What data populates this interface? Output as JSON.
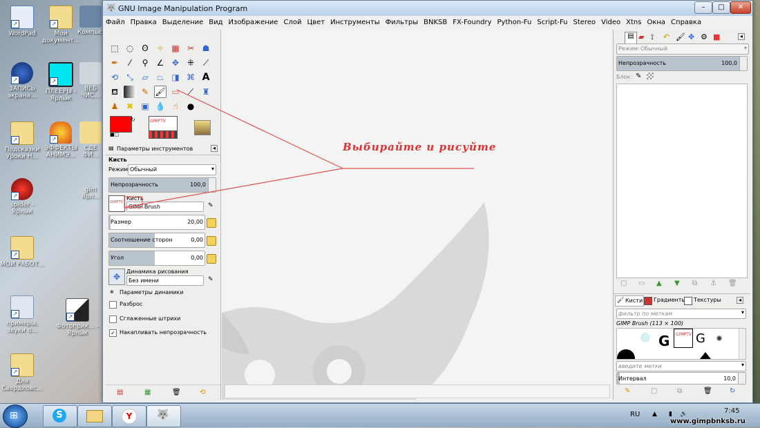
{
  "desktop": {
    "icons": [
      {
        "label": "WordPad"
      },
      {
        "label": "Мои документ..."
      },
      {
        "label": "Компьютер"
      },
      {
        "label": "ЗАПИСЬ экрана..."
      },
      {
        "label": "ПЛЕЕРЫ - Ярлык"
      },
      {
        "label": "ВЕБ ЧИС..."
      },
      {
        "label": "Подсказки Уроки Н..."
      },
      {
        "label": "ЭФФЕКТЫ АНИМЭ..."
      },
      {
        "label": "СДЕ ФИ..."
      },
      {
        "label": "spider - Ярлык"
      },
      {
        "label": "gim Ярл..."
      },
      {
        "label": "МОИ РАБОТ..."
      },
      {
        "label": "примеры, звуки о..."
      },
      {
        "label": "Фотоприк... - Ярлык"
      },
      {
        "label": "Для Свердловс..."
      }
    ]
  },
  "window": {
    "title": "GNU Image Manipulation Program",
    "minimize": "–",
    "maximize": "□",
    "close": "✕"
  },
  "menubar": [
    "Файл",
    "Правка",
    "Выделение",
    "Вид",
    "Изображение",
    "Слой",
    "Цвет",
    "Инструменты",
    "Фильтры",
    "BNKSB",
    "FX-Foundry",
    "Python-Fu",
    "Script-Fu",
    "Stereo",
    "Video",
    "Xtns",
    "Окна",
    "Справка"
  ],
  "toolbox": {
    "tab_title": "Параметры инструментов",
    "tool_name": "Кисть",
    "mode_label": "Режим:",
    "mode_value": "Обычный",
    "opacity_label": "Непрозрачность",
    "opacity_value": "100,0",
    "opacity_fraction": 1.0,
    "brush_label": "Кисть",
    "brush_value": "GIMP Brush",
    "size_label": "Размер",
    "size_value": "20,00",
    "aspect_label": "Соотношение сторон",
    "aspect_value": "0,00",
    "angle_label": "Угол",
    "angle_value": "0,00",
    "dynamics_label": "Динамика рисования",
    "dynamics_value": "Без имени",
    "dynamics_params": "Параметры динамики",
    "scatter": "Разброс",
    "smooth": "Сглаженные штрихи",
    "accumulate": "Накапливать непрозрачность",
    "brush_thumb_text": "GIMPTV",
    "fg_color": "#ff0000",
    "bg_color": "#ffffff"
  },
  "annotation": {
    "text": "Выбирайте и рисуйте",
    "color": "#e03030"
  },
  "layers": {
    "mode_label": "Режим:",
    "mode_value": "Обычный",
    "opacity_label": "Непрозрачность",
    "opacity_value": "100,0",
    "lock_label": "Блок:"
  },
  "brushes": {
    "tab_brushes": "Кисти",
    "tab_gradients": "Градиенты",
    "tab_textures": "Текстуры",
    "filter_placeholder": "фильтр по меткам",
    "current": "GIMP Brush (113 × 100)",
    "tags_placeholder": "введите метки",
    "spacing_label": "Интервал",
    "spacing_value": "10,0",
    "thumb_letter": "G",
    "thumb_text": "GIMPTV"
  },
  "taskbar": {
    "lang": "RU",
    "time": "7:45",
    "watermark": "www.gimpbnksb.ru"
  }
}
